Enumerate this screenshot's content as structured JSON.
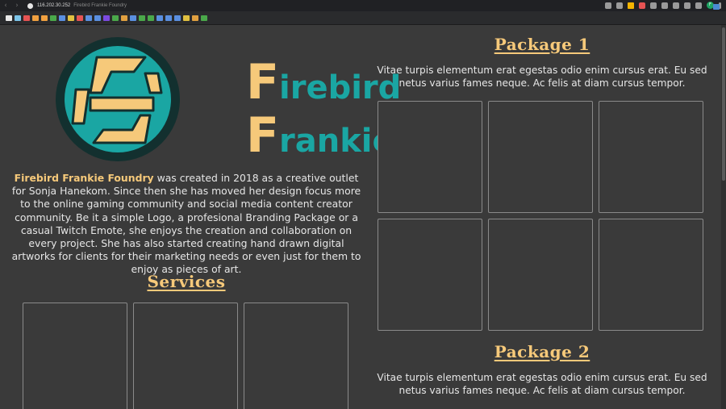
{
  "browser": {
    "url_host": "116.202.30.252",
    "tab_title": "Firebird Frankie Foundry",
    "back_icon": "back-arrow-icon",
    "forward_icon": "forward-arrow-icon",
    "profile_initial": "F"
  },
  "bookmarks": {
    "colors": [
      "#e8e8e8",
      "#7cc4e8",
      "#e55353",
      "#f0a040",
      "#f0a040",
      "#4aa84a",
      "#5a8fe0",
      "#e0c040",
      "#e55353",
      "#5a8fe0",
      "#5a8fe0",
      "#7c4ae0",
      "#4aa84a",
      "#e0a040",
      "#5a8fe0",
      "#4aa84a",
      "#4aa84a",
      "#5a8fe0",
      "#5a8fe0",
      "#5a8fe0",
      "#e0c040",
      "#e0a040",
      "#4aa84a"
    ]
  },
  "logo": {
    "word1_cap": "F",
    "word1_rest": "irebird",
    "word2_cap": "F",
    "word2_rest": "rankie",
    "colors": {
      "teal": "#1aa6a3",
      "gold": "#f6c97a",
      "dark": "#13302f"
    }
  },
  "intro": {
    "brand": "Firebird Frankie Foundry",
    "text": " was created in 2018 as a creative outlet for Sonja Hanekom. Since then she has moved her design focus more to the online gaming community and social media content creator community. Be it a simple Logo, a profesional Branding Package or a casual Twitch Emote, she enjoys the creation and collaboration on every project. She has also started creating hand drawn digital artworks for clients for their marketing needs or even just for them to enjoy as pieces of art."
  },
  "services": {
    "title": "Services"
  },
  "package1": {
    "title": "Package 1",
    "text": "Vitae turpis elementum erat egestas odio enim cursus erat. Eu sed netus varius fames neque. Ac felis at diam cursus tempor."
  },
  "package2": {
    "title": "Package 2",
    "text": "Vitae turpis elementum erat egestas odio enim cursus erat. Eu sed netus varius fames neque. Ac felis at diam cursus tempor."
  }
}
